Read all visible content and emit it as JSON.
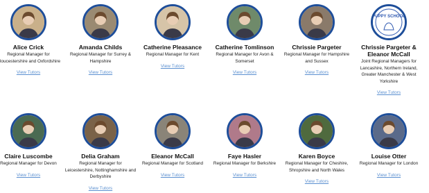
{
  "managers": [
    {
      "name": "Alice Crick",
      "role": "Regional Manager for Gloucestershire and Oxfordshire",
      "link": "View Tutors",
      "avatar_color": "#c9b08a"
    },
    {
      "name": "Amanda Childs",
      "role": "Regional Manager for Surrey & Hampshire",
      "link": "View Tutors",
      "avatar_color": "#9a8a72"
    },
    {
      "name": "Catherine Pleasance",
      "role": "Regional Manager for Kent",
      "link": "View Tutors",
      "avatar_color": "#d6c4a8"
    },
    {
      "name": "Catherine Tomlinson",
      "role": "Regional Manager for Avon & Somerset",
      "link": "View Tutors",
      "avatar_color": "#6f8a6a"
    },
    {
      "name": "Chrissie Pargeter",
      "role": "Regional Manager for Hampshire and Sussex",
      "link": "View Tutors",
      "avatar_color": "#8a7a6a"
    },
    {
      "name": "Chrissie Pargeter & Eleanor McCall",
      "role": "Joint Regional Managers for Lancashire, Northern Ireland, Greater Manchester & West Yorkshire",
      "link": "View Tutors",
      "avatar_color": "#ffffff",
      "logo_text": "PUPPY SCHOOL"
    },
    {
      "name": "Claire Luscombe",
      "role": "Regional Manager for Devon",
      "link": "View Tutors",
      "avatar_color": "#4a6a52"
    },
    {
      "name": "Delia Graham",
      "role": "Regional Manager for Leicestershire, Nottinghamshire and Derbyshire",
      "link": "View Tutors",
      "avatar_color": "#7a6248"
    },
    {
      "name": "Eleanor McCall",
      "role": "Regional Manager for Scotland",
      "link": "View Tutors",
      "avatar_color": "#8a8478"
    },
    {
      "name": "Faye Hasler",
      "role": "Regional Manager for Berkshire",
      "link": "View Tutors",
      "avatar_color": "#b07a8a"
    },
    {
      "name": "Karen Boyce",
      "role": "Regional Manager for Cheshire, Shropshire and North Wales",
      "link": "View Tutors",
      "avatar_color": "#4f6a3e"
    },
    {
      "name": "Louise Otter",
      "role": "Regional Manager for London",
      "link": "View Tutors",
      "avatar_color": "#5a6a8a"
    }
  ]
}
